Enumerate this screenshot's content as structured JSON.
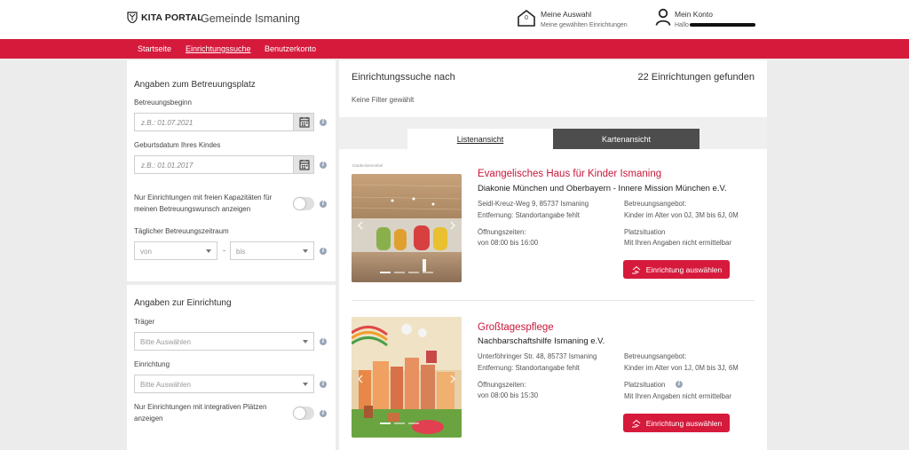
{
  "header": {
    "brand": "KITA PORTAL",
    "municipality": "Gemeinde Ismaning",
    "my_selection": {
      "title": "Meine Auswahl",
      "subtitle": "Meine gewählten Einrichtungen",
      "count": "0"
    },
    "account": {
      "title": "Mein Konto",
      "greeting": "Hallo"
    }
  },
  "nav": {
    "items": [
      {
        "label": "Startseite"
      },
      {
        "label": "Einrichtungssuche"
      },
      {
        "label": "Benutzerkonto"
      }
    ]
  },
  "sidebar": {
    "care": {
      "title": "Angaben zum Betreuungsplatz",
      "start_label": "Betreuungsbeginn",
      "start_placeholder": "z.B.: 01.07.2021",
      "birth_label": "Geburtsdatum Ihres Kindes",
      "birth_placeholder": "z.B.: 01.01.2017",
      "free_capacity_label": "Nur Einrichtungen mit freien Kapazitäten für meinen Betreuungswunsch anzeigen",
      "daily_label": "Täglicher Betreuungszeitraum",
      "from_placeholder": "von",
      "to_placeholder": "bis",
      "separator": "-"
    },
    "facility": {
      "title": "Angaben zur Einrichtung",
      "carrier_label": "Träger",
      "carrier_placeholder": "Bitte Auswählen",
      "facility_label": "Einrichtung",
      "facility_placeholder": "Bitte Auswählen",
      "integrative_label": "Nur Einrichtungen mit integrativen Plätzen anzeigen"
    }
  },
  "main": {
    "search_title": "Einrichtungssuche nach",
    "results_count": "22 Einrichtungen gefunden",
    "filters": "Keine Filter gewählt",
    "tabs": [
      {
        "label": "Listenansicht"
      },
      {
        "label": "Kartenansicht"
      }
    ],
    "results": [
      {
        "name": "Evangelisches Haus für Kinder Ismaning",
        "org": "Diakonie München und Oberbayern - Innere Mission München e.V.",
        "address": "Seidl-Kreuz-Weg 9, 85737 Ismaning",
        "distance": "Entfernung: Standortangabe fehlt",
        "hours_label": "Öffnungszeiten:",
        "hours": "von 08:00 bis 16:00",
        "offer_label": "Betreuungsangebot:",
        "offer": "Kinder im Alter von 0J, 3M bis 6J, 0M",
        "spot_label": "Platzsituation",
        "spot": "Mit Ihren Angaben nicht ermittelbar",
        "button": "Einrichtung auswählen",
        "image_caption": "Gardeckenmöbel"
      },
      {
        "name": "Großtagespflege",
        "org": "Nachbarschaftshilfe Ismaning e.V.",
        "address": "Unterföhringer Str. 48, 85737 Ismaning",
        "distance": "Entfernung: Standortangabe fehlt",
        "hours_label": "Öffnungszeiten:",
        "hours": "von 08:00 bis 15:30",
        "offer_label": "Betreuungsangebot:",
        "offer": "Kinder im Alter von 1J, 0M bis 3J, 6M",
        "spot_label": "Platzsituation",
        "spot": "Mit Ihren Angaben nicht ermittelbar",
        "button": "Einrichtung auswählen"
      }
    ]
  },
  "colors": {
    "brand_red": "#d61a3c",
    "name_red": "#c8183b",
    "tab_dark": "#4d4d4d"
  },
  "icons": [
    "crest-icon",
    "house-icon",
    "person-icon",
    "calendar-icon",
    "info-icon",
    "caret-down-icon",
    "hand-house-icon",
    "chevron-left-icon",
    "chevron-right-icon"
  ]
}
